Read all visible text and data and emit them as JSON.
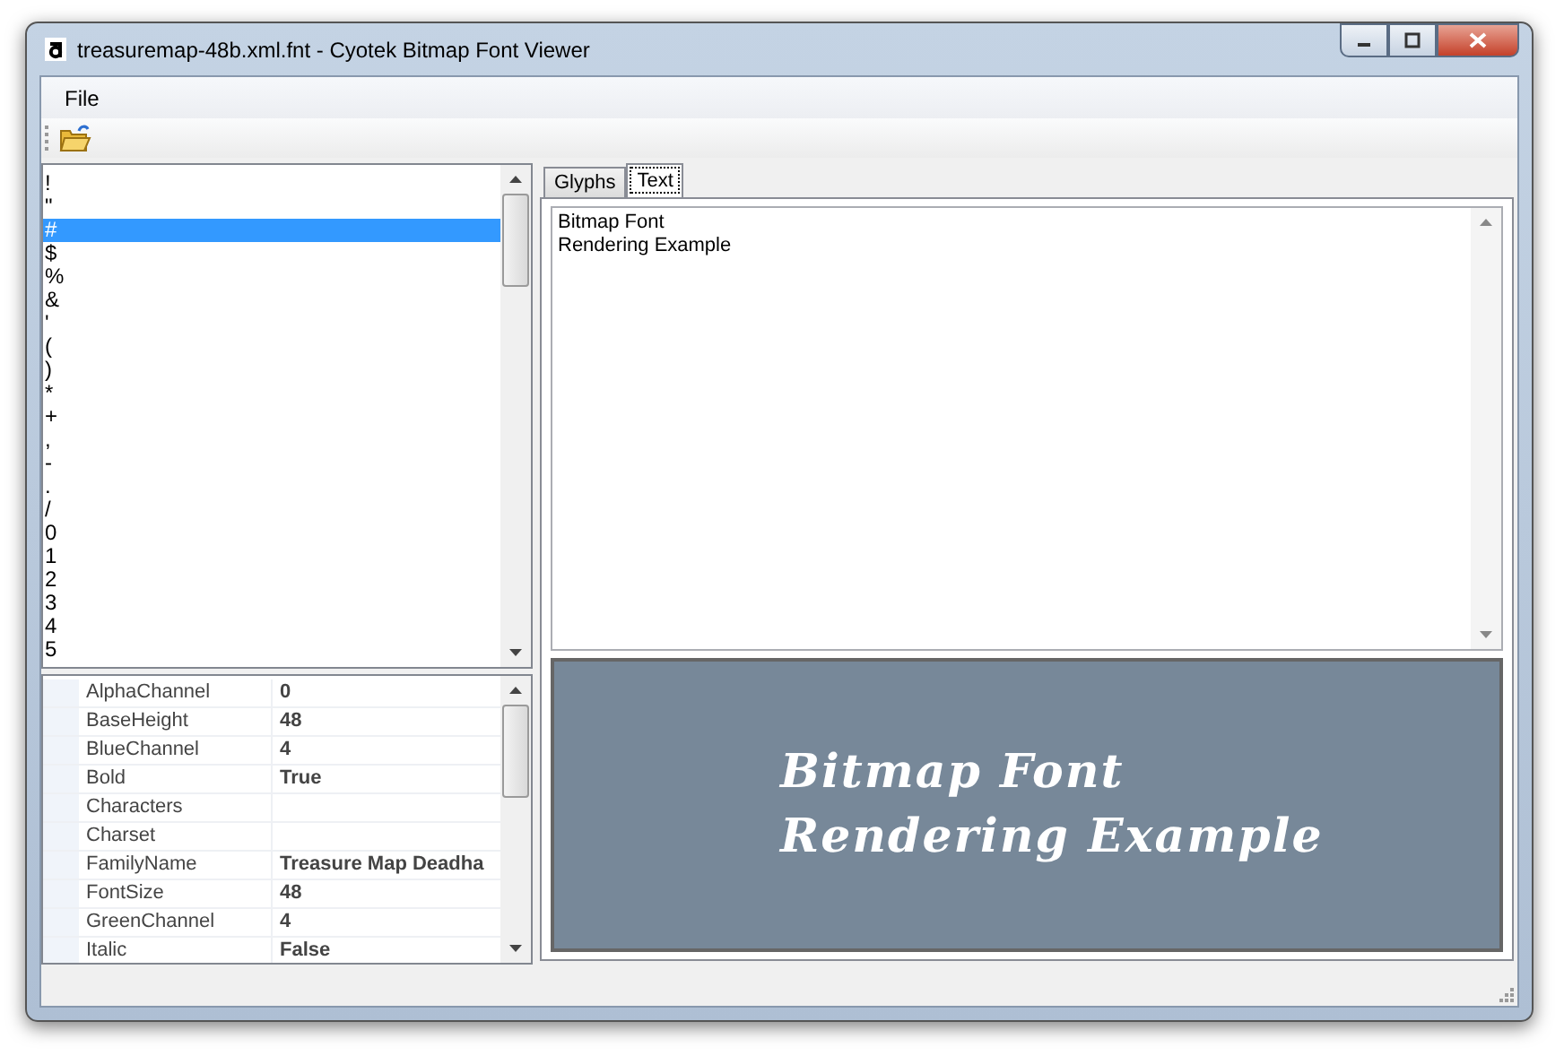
{
  "window": {
    "title": "treasuremap-48b.xml.fnt - Cyotek Bitmap Font Viewer"
  },
  "menu": [
    "File"
  ],
  "glyphs": [
    {
      "label": "!",
      "selected": false
    },
    {
      "label": "\"",
      "selected": false
    },
    {
      "label": "#",
      "selected": true
    },
    {
      "label": "$",
      "selected": false
    },
    {
      "label": "%",
      "selected": false
    },
    {
      "label": "&",
      "selected": false
    },
    {
      "label": "'",
      "selected": false
    },
    {
      "label": "(",
      "selected": false
    },
    {
      "label": ")",
      "selected": false
    },
    {
      "label": "*",
      "selected": false
    },
    {
      "label": "+",
      "selected": false
    },
    {
      "label": ",",
      "selected": false
    },
    {
      "label": "-",
      "selected": false
    },
    {
      "label": ".",
      "selected": false
    },
    {
      "label": "/",
      "selected": false
    },
    {
      "label": "0",
      "selected": false
    },
    {
      "label": "1",
      "selected": false
    },
    {
      "label": "2",
      "selected": false
    },
    {
      "label": "3",
      "selected": false
    },
    {
      "label": "4",
      "selected": false
    },
    {
      "label": "5",
      "selected": false
    }
  ],
  "properties": [
    {
      "name": "AlphaChannel",
      "value": "0"
    },
    {
      "name": "BaseHeight",
      "value": "48"
    },
    {
      "name": "BlueChannel",
      "value": "4"
    },
    {
      "name": "Bold",
      "value": "True"
    },
    {
      "name": "Characters"
    },
    {
      "name": "Charset"
    },
    {
      "name": "FamilyName",
      "value": "Treasure Map Deadha"
    },
    {
      "name": "FontSize",
      "value": "48"
    },
    {
      "name": "GreenChannel",
      "value": "4"
    },
    {
      "name": "Italic",
      "value": "False"
    }
  ],
  "tabs": [
    {
      "label": "Glyphs",
      "selected": false
    },
    {
      "label": "Text",
      "selected": true
    }
  ],
  "text_input": {
    "value": "Bitmap Font\nRendering Example"
  },
  "preview_lines": [
    "Bitmap Font",
    "Rendering Example"
  ]
}
